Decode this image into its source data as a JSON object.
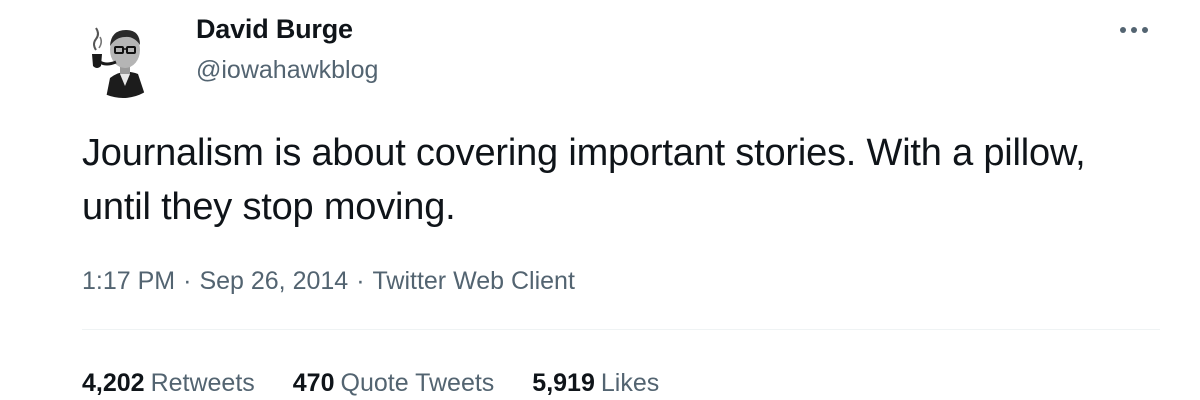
{
  "author": {
    "display_name": "David Burge",
    "handle": "@iowahawkblog"
  },
  "tweet": {
    "text": "Journalism is about covering important stories. With a pillow, until they stop moving."
  },
  "meta": {
    "time": "1:17 PM",
    "separator": "·",
    "date": "Sep 26, 2014",
    "client": "Twitter Web Client"
  },
  "stats": {
    "retweets": {
      "count": "4,202",
      "label": "Retweets"
    },
    "quote_tweets": {
      "count": "470",
      "label": "Quote Tweets"
    },
    "likes": {
      "count": "5,919",
      "label": "Likes"
    }
  },
  "icons": {
    "more": "more-horizontal-icon"
  },
  "colors": {
    "text_primary": "#0f1419",
    "text_secondary": "#536471",
    "divider": "#eff3f4"
  }
}
